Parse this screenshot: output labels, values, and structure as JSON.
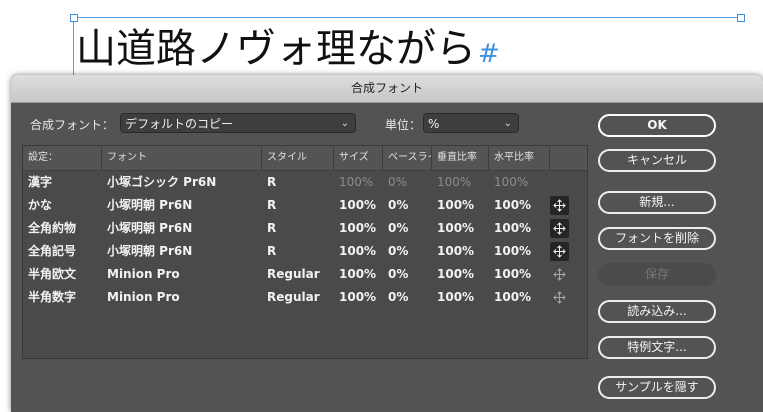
{
  "document": {
    "sample_text": "山道路ノヴォ理ながら",
    "hash_mark": "#"
  },
  "dialog": {
    "title": "合成フォント",
    "composite_font_label": "合成フォント：",
    "composite_font_value": "デフォルトのコピー",
    "unit_label": "単位：",
    "unit_value": "%",
    "table": {
      "headers": [
        "設定：",
        "フォント",
        "スタイル",
        "サイズ",
        "ベースライン",
        "垂直比率",
        "水平比率"
      ],
      "rows": [
        {
          "setting": "漢字",
          "font": "小塚ゴシック Pr6N",
          "style": "R",
          "size": "100%",
          "baseline": "0%",
          "vscale": "100%",
          "hscale": "100%",
          "dim": true,
          "move": "none"
        },
        {
          "setting": "かな",
          "font": "小塚明朝 Pr6N",
          "style": "R",
          "size": "100%",
          "baseline": "0%",
          "vscale": "100%",
          "hscale": "100%",
          "dim": false,
          "move": "dark"
        },
        {
          "setting": "全角約物",
          "font": "小塚明朝 Pr6N",
          "style": "R",
          "size": "100%",
          "baseline": "0%",
          "vscale": "100%",
          "hscale": "100%",
          "dim": false,
          "move": "dark"
        },
        {
          "setting": "全角記号",
          "font": "小塚明朝 Pr6N",
          "style": "R",
          "size": "100%",
          "baseline": "0%",
          "vscale": "100%",
          "hscale": "100%",
          "dim": false,
          "move": "dark"
        },
        {
          "setting": "半角欧文",
          "font": "Minion Pro",
          "style": "Regular",
          "size": "100%",
          "baseline": "0%",
          "vscale": "100%",
          "hscale": "100%",
          "dim": false,
          "move": "light"
        },
        {
          "setting": "半角数字",
          "font": "Minion Pro",
          "style": "Regular",
          "size": "100%",
          "baseline": "0%",
          "vscale": "100%",
          "hscale": "100%",
          "dim": false,
          "move": "light"
        }
      ]
    },
    "buttons": {
      "ok": "OK",
      "cancel": "キャンセル",
      "new": "新規...",
      "delete_font": "フォントを削除",
      "save": "保存",
      "load": "読み込み...",
      "exceptions": "特例文字...",
      "hide_sample": "サンプルを隠す"
    }
  }
}
